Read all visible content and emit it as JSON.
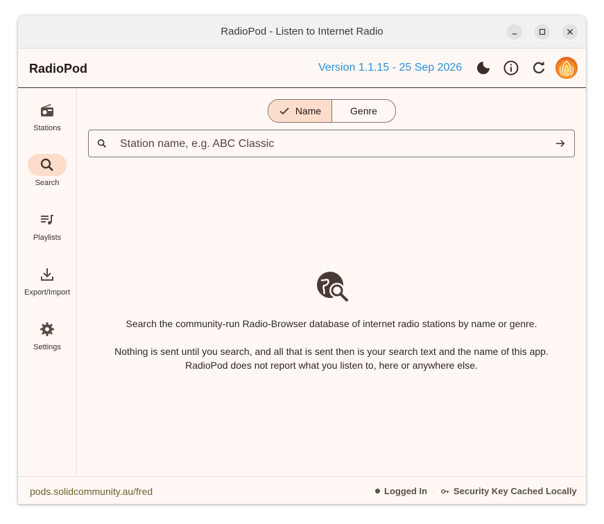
{
  "window": {
    "title": "RadioPod - Listen to Internet Radio"
  },
  "appbar": {
    "app_name": "RadioPod",
    "version": "Version 1.1.15 - 25 Sep 2026",
    "icons": [
      "dark-mode-icon",
      "info-icon",
      "refresh-icon",
      "app-logo"
    ]
  },
  "sidebar": {
    "items": [
      {
        "label": "Stations",
        "icon": "radio-icon",
        "active": false
      },
      {
        "label": "Search",
        "icon": "search-icon",
        "active": true
      },
      {
        "label": "Playlists",
        "icon": "playlist-icon",
        "active": false
      },
      {
        "label": "Export/Import",
        "icon": "download-icon",
        "active": false
      },
      {
        "label": "Settings",
        "icon": "gear-icon",
        "active": false
      }
    ]
  },
  "search_mode": {
    "options": [
      {
        "label": "Name",
        "selected": true
      },
      {
        "label": "Genre",
        "selected": false
      }
    ]
  },
  "search": {
    "placeholder": "Station name, e.g. ABC Classic",
    "value": ""
  },
  "empty_state": {
    "icon": "travel-explore-icon",
    "line1": "Search the community-run Radio-Browser database of internet radio stations by name or genre.",
    "line2": "Nothing is sent until you search, and all that is sent then is your search text and the name of this app.",
    "line3": "RadioPod does not report what you listen to, here or anywhere else."
  },
  "footer": {
    "pod_url": "pods.solidcommunity.au/fred",
    "logged_in": "Logged In",
    "security": "Security Key Cached Locally"
  },
  "colors": {
    "accent_link": "#2e8fd6",
    "selected_bg": "#fcdccb",
    "background": "#fff8f5"
  }
}
